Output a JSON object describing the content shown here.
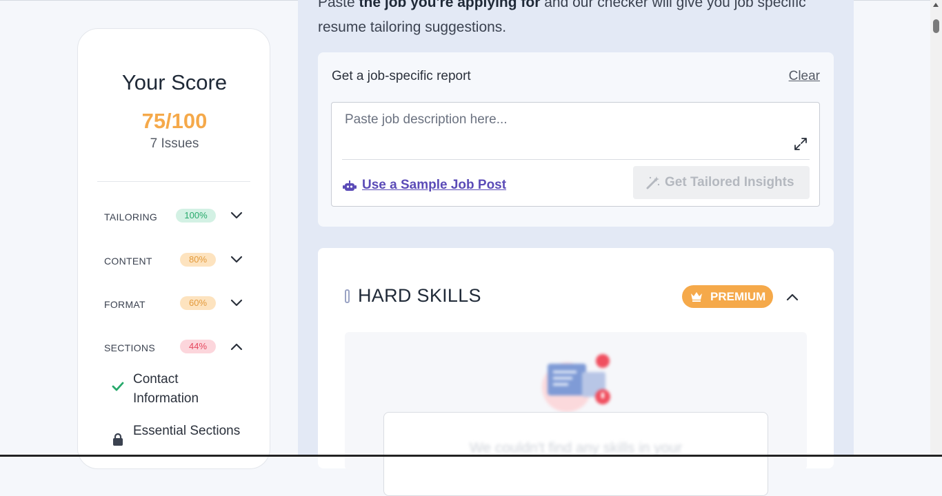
{
  "score": {
    "title": "Your Score",
    "value": "75/100",
    "issues": "7 Issues"
  },
  "categories": [
    {
      "label": "TAILORING",
      "percent": "100%",
      "badge_bg": "#d3f1e4",
      "badge_color": "#27a96b",
      "expanded": false
    },
    {
      "label": "CONTENT",
      "percent": "80%",
      "badge_bg": "#fde3bf",
      "badge_color": "#e39a3b",
      "expanded": false
    },
    {
      "label": "FORMAT",
      "percent": "60%",
      "badge_bg": "#fde3bf",
      "badge_color": "#e39a3b",
      "expanded": false
    },
    {
      "label": "SECTIONS",
      "percent": "44%",
      "badge_bg": "#fcd6dc",
      "badge_color": "#e5485e",
      "expanded": true
    }
  ],
  "sections_items": [
    {
      "label": "Contact Information",
      "icon": "check-icon"
    },
    {
      "label": "Essential Sections",
      "icon": "lock-icon"
    }
  ],
  "main": {
    "intro_bold": "the job you're applying for",
    "intro_pre": "Paste ",
    "intro_post": " and our checker will give you job specific resume tailoring suggestions."
  },
  "report": {
    "title": "Get a job-specific report",
    "clear_label": "Clear",
    "placeholder": "Paste job description here...",
    "sample_link": "Use a Sample Job Post",
    "insights_button": "Get Tailored Insights"
  },
  "skills": {
    "title": "HARD SKILLS",
    "premium_label": "PREMIUM",
    "locked_text": "We couldn't find any skills in your"
  },
  "colors": {
    "accent_orange": "#f5a94a",
    "link_purple": "#5b4bb7",
    "check_green": "#27a96b"
  }
}
